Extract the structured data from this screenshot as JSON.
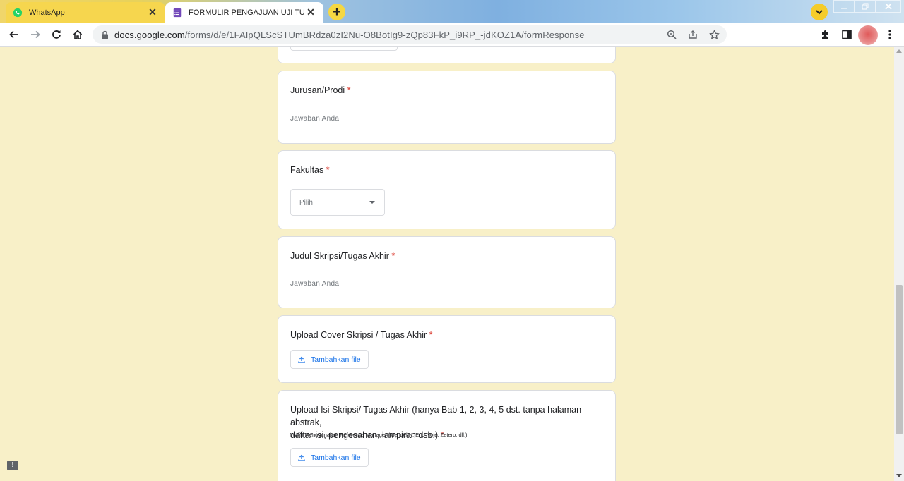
{
  "tabs": [
    {
      "title": "WhatsApp",
      "icon": "whatsapp-icon"
    },
    {
      "title": "FORMULIR PENGAJUAN UJI TURNITIN",
      "icon": "google-forms-icon"
    }
  ],
  "address_bar": {
    "host": "docs.google.com",
    "path": "/forms/d/e/1FAIpQLScSTUmBRdza0zI2Nu-O8BotIg9-zQp83FkP_i9RP_-jdKOZ1A/formResponse"
  },
  "form": {
    "required_mark": "*",
    "q_jurusan": {
      "title": "Jurusan/Prodi",
      "placeholder": "Jawaban Anda"
    },
    "q_fakultas": {
      "title": "Fakultas",
      "select_value": "Pilih"
    },
    "q_judul": {
      "title": "Judul Skripsi/Tugas Akhir",
      "placeholder": "Jawaban Anda"
    },
    "q_cover": {
      "title": "Upload Cover Skripsi / Tugas Akhir",
      "button": "Tambahkan file"
    },
    "q_isi": {
      "title_line1": "Upload Isi Skripsi/ Tugas Akhir (hanya Bab 1, 2, 3, 4, 5 dst. tanpa halaman abstrak,",
      "title_line2": "daftar isi, pengesahan, lampiran dsb.)",
      "description": "Wajib Menggunakan Reference Manager (Mendeley, End Note, Zetero, dll.)",
      "button": "Tambahkan file"
    }
  },
  "colors": {
    "page_bg": "#f8f0c8",
    "required": "#d93025",
    "link_blue": "#1a73e8",
    "forms_purple": "#7248b9"
  }
}
